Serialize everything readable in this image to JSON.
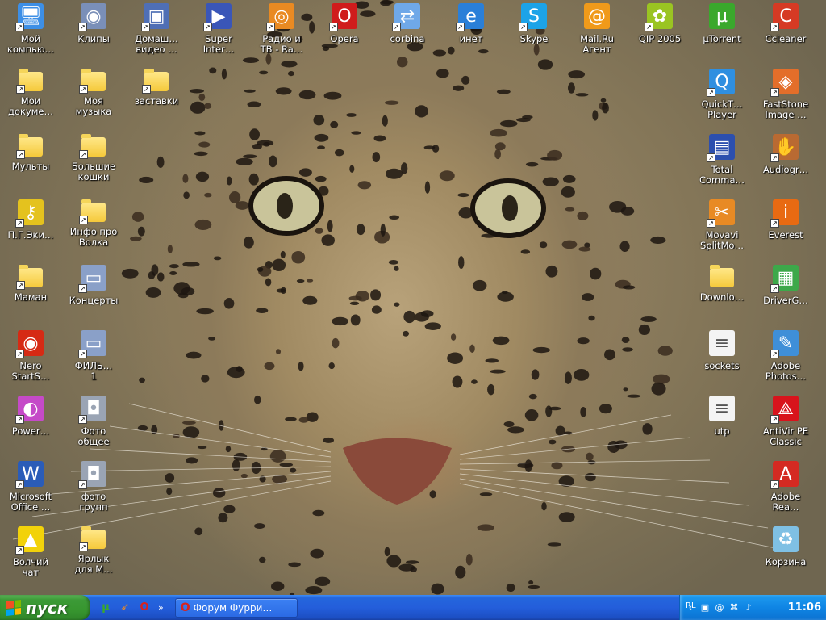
{
  "desktop": {
    "icons": [
      {
        "label": "Мой\nкомпью…",
        "icon": "my-computer-icon",
        "color": "#3d8fe6",
        "col": 0,
        "row": 0,
        "type": "app",
        "shortcut": true
      },
      {
        "label": "Клипы",
        "icon": "disc-icon",
        "color": "#7a8fb8",
        "col": 1,
        "row": 0,
        "type": "app",
        "shortcut": true
      },
      {
        "label": "Домаш…\nвидео …",
        "icon": "computer-icon",
        "color": "#4f6fb5",
        "col": 2,
        "row": 0,
        "type": "app",
        "shortcut": true
      },
      {
        "label": "Super\nInter…",
        "icon": "video-player-icon",
        "color": "#3a56b8",
        "col": 3,
        "row": 0,
        "type": "app",
        "shortcut": true
      },
      {
        "label": "Радио и\nТВ - Ra…",
        "icon": "radio-tv-icon",
        "color": "#e98a22",
        "col": 4,
        "row": 0,
        "type": "app",
        "shortcut": true
      },
      {
        "label": "Opera",
        "icon": "opera-icon",
        "color": "#d01c1c",
        "col": 5,
        "row": 0,
        "type": "app",
        "shortcut": true
      },
      {
        "label": "corbina",
        "icon": "network-icon",
        "color": "#6fa8e8",
        "col": 6,
        "row": 0,
        "type": "app",
        "shortcut": true
      },
      {
        "label": "инет",
        "icon": "internet-explorer-icon",
        "color": "#2a7fd8",
        "col": 7,
        "row": 0,
        "type": "app",
        "shortcut": true
      },
      {
        "label": "Skype",
        "icon": "skype-icon",
        "color": "#1ca3e8",
        "col": 8,
        "row": 0,
        "type": "app",
        "shortcut": true
      },
      {
        "label": "Mail.Ru\nАгент",
        "icon": "mail-agent-icon",
        "color": "#f09a1a",
        "col": 9,
        "row": 0,
        "type": "app",
        "shortcut": false
      },
      {
        "label": "QIP 2005",
        "icon": "qip-icon",
        "color": "#9ac422",
        "col": 10,
        "row": 0,
        "type": "app",
        "shortcut": true
      },
      {
        "label": "µTorrent",
        "icon": "utorrent-icon",
        "color": "#3aa82c",
        "col": 11,
        "row": 0,
        "type": "app",
        "shortcut": false
      },
      {
        "label": "Ccleaner",
        "icon": "ccleaner-icon",
        "color": "#d63a24",
        "col": 12,
        "row": 0,
        "type": "app",
        "shortcut": true
      },
      {
        "label": "Мои\nдокуме…",
        "icon": "my-documents-icon",
        "color": "#f3d35b",
        "col": 0,
        "row": 1,
        "type": "folder",
        "shortcut": true
      },
      {
        "label": "Моя\nмузыка",
        "icon": "folder-icon",
        "color": "#f3d35b",
        "col": 1,
        "row": 1,
        "type": "folder",
        "shortcut": true
      },
      {
        "label": "заставки",
        "icon": "folder-icon",
        "color": "#f3d35b",
        "col": 2,
        "row": 1,
        "type": "folder",
        "shortcut": true
      },
      {
        "label": "QuickT…\nPlayer",
        "icon": "quicktime-icon",
        "color": "#2f8fe0",
        "col": 11,
        "row": 1,
        "type": "app",
        "shortcut": true
      },
      {
        "label": "FastStone\nImage …",
        "icon": "faststone-icon",
        "color": "#e36e2a",
        "col": 12,
        "row": 1,
        "type": "app",
        "shortcut": true
      },
      {
        "label": "Мульты",
        "icon": "folder-icon",
        "color": "#f3d35b",
        "col": 0,
        "row": 2,
        "type": "folder",
        "shortcut": true
      },
      {
        "label": "Большие\nкошки",
        "icon": "folder-icon",
        "color": "#f3d35b",
        "col": 1,
        "row": 2,
        "type": "folder",
        "shortcut": true
      },
      {
        "label": "Total\nComma…",
        "icon": "total-commander-icon",
        "color": "#2c4fae",
        "col": 11,
        "row": 2,
        "type": "app",
        "shortcut": true
      },
      {
        "label": "Audiogr…",
        "icon": "audiograbber-icon",
        "color": "#b96a32",
        "col": 12,
        "row": 2,
        "type": "app",
        "shortcut": true
      },
      {
        "label": "П.Г.Эки…",
        "icon": "key-icon",
        "color": "#e4c21e",
        "col": 0,
        "row": 3,
        "type": "app",
        "shortcut": true
      },
      {
        "label": "Инфо про\nВолка",
        "icon": "folder-icon",
        "color": "#f3d35b",
        "col": 1,
        "row": 3,
        "type": "folder",
        "shortcut": true
      },
      {
        "label": "Movavi\nSplitMo…",
        "icon": "movavi-icon",
        "color": "#e88a24",
        "col": 11,
        "row": 3,
        "type": "app",
        "shortcut": true
      },
      {
        "label": "Everest",
        "icon": "everest-icon",
        "color": "#e86a12",
        "col": 12,
        "row": 3,
        "type": "app",
        "shortcut": true
      },
      {
        "label": "Маман",
        "icon": "folder-icon",
        "color": "#f3d35b",
        "col": 0,
        "row": 4,
        "type": "folder",
        "shortcut": true
      },
      {
        "label": "Концерты",
        "icon": "video-camera-icon",
        "color": "#8aa0c8",
        "col": 1,
        "row": 4,
        "type": "app",
        "shortcut": true
      },
      {
        "label": "Downlo…",
        "icon": "folder-icon",
        "color": "#f3d35b",
        "col": 11,
        "row": 4,
        "type": "folder",
        "shortcut": false
      },
      {
        "label": "DriverG…",
        "icon": "driver-genius-icon",
        "color": "#3da84a",
        "col": 12,
        "row": 4,
        "type": "app",
        "shortcut": true
      },
      {
        "label": "Nero\nStartS…",
        "icon": "nero-icon",
        "color": "#d62a14",
        "col": 0,
        "row": 5,
        "type": "app",
        "shortcut": true
      },
      {
        "label": "ФИЛЬ…\n1",
        "icon": "video-camera-icon",
        "color": "#8aa0c8",
        "col": 1,
        "row": 5,
        "type": "app",
        "shortcut": true
      },
      {
        "label": "sockets",
        "icon": "text-file-icon",
        "color": "#f4f4f4",
        "col": 11,
        "row": 5,
        "type": "file",
        "shortcut": false
      },
      {
        "label": "Adobe\nPhotos…",
        "icon": "photoshop-icon",
        "color": "#3f8fd8",
        "col": 12,
        "row": 5,
        "type": "app",
        "shortcut": true
      },
      {
        "label": "Power…",
        "icon": "powerdvd-icon",
        "color": "#c54ac8",
        "col": 0,
        "row": 6,
        "type": "app",
        "shortcut": true
      },
      {
        "label": "Фото\nобщее",
        "icon": "camera-icon",
        "color": "#9aa4b4",
        "col": 1,
        "row": 6,
        "type": "app",
        "shortcut": true
      },
      {
        "label": "utp",
        "icon": "text-file-icon",
        "color": "#f4f4f4",
        "col": 11,
        "row": 6,
        "type": "file",
        "shortcut": false
      },
      {
        "label": "AntiVir PE\nClassic",
        "icon": "antivir-icon",
        "color": "#d8141c",
        "col": 12,
        "row": 6,
        "type": "app",
        "shortcut": true
      },
      {
        "label": "Microsoft\nOffice …",
        "icon": "word-icon",
        "color": "#2a5cb8",
        "col": 0,
        "row": 7,
        "type": "app",
        "shortcut": true
      },
      {
        "label": "фото\nгрупп",
        "icon": "camera-icon",
        "color": "#9aa4b4",
        "col": 1,
        "row": 7,
        "type": "app",
        "shortcut": true
      },
      {
        "label": "Adobe\nRea…",
        "icon": "adobe-reader-icon",
        "color": "#d42a22",
        "col": 12,
        "row": 7,
        "type": "app",
        "shortcut": true
      },
      {
        "label": "Волчий\nчат",
        "icon": "wolf-chat-icon",
        "color": "#f2d20a",
        "col": 0,
        "row": 8,
        "type": "app",
        "shortcut": true
      },
      {
        "label": "Ярлык\nдля М…",
        "icon": "folder-icon",
        "color": "#f3d35b",
        "col": 1,
        "row": 8,
        "type": "folder",
        "shortcut": true
      },
      {
        "label": "Корзина",
        "icon": "recycle-bin-icon",
        "color": "#7fc0e4",
        "col": 12,
        "row": 8,
        "type": "app",
        "shortcut": false
      }
    ]
  },
  "taskbar": {
    "start_label": "пуск",
    "quick_launch": [
      {
        "icon": "utorrent-icon",
        "glyph": "µ",
        "color": "#3aa82c"
      },
      {
        "icon": "arrow-app-icon",
        "glyph": "➶",
        "color": "#f28c1e"
      },
      {
        "icon": "opera-icon",
        "glyph": "O",
        "color": "#d9231c"
      }
    ],
    "quick_launch_more": "»",
    "task": {
      "label": "Форум Фурри…",
      "icon": "opera-icon"
    },
    "tray": {
      "language": "RL",
      "icons": [
        {
          "icon": "tray-arrow-icon",
          "glyph": "‹"
        },
        {
          "icon": "network-tray-icon",
          "glyph": "▣"
        },
        {
          "icon": "qip-tray-icon",
          "glyph": "@"
        },
        {
          "icon": "device-tray-icon",
          "glyph": "⌘"
        },
        {
          "icon": "volume-tray-icon",
          "glyph": "♪"
        }
      ],
      "clock": "11:06"
    }
  }
}
